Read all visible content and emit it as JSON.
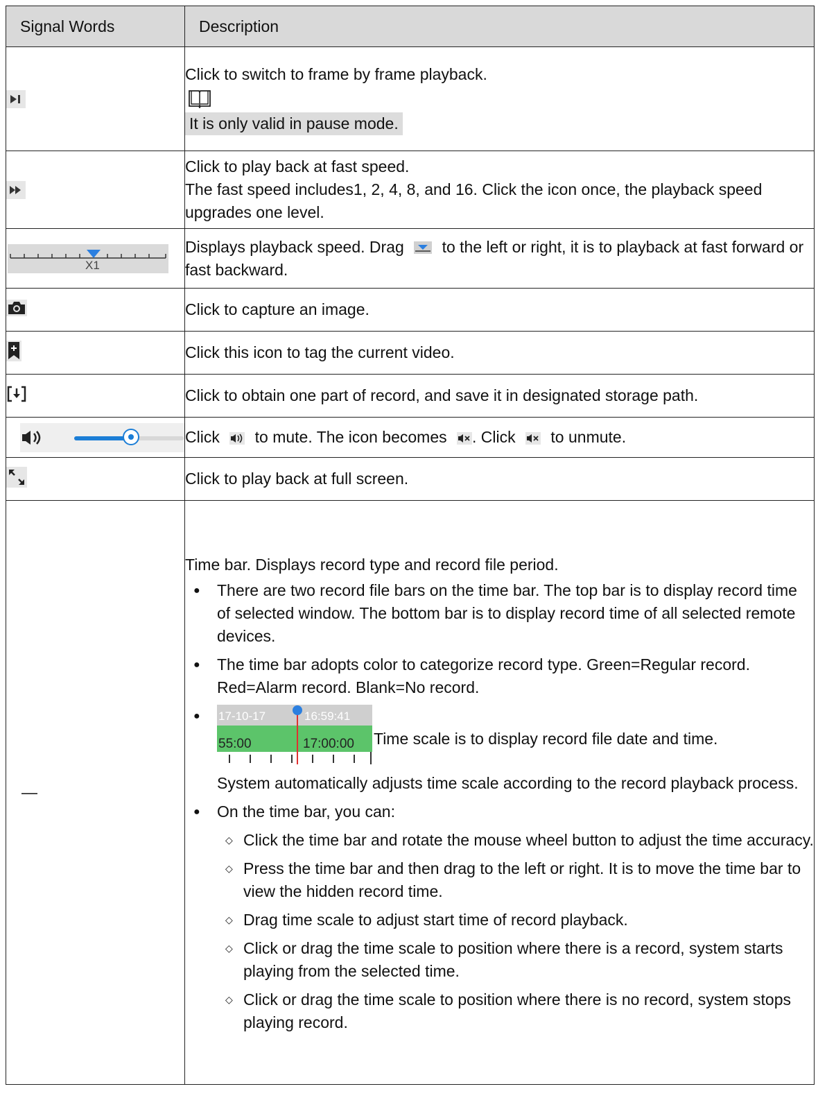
{
  "header": {
    "col1": "Signal Words",
    "col2": "Description"
  },
  "rows": {
    "frame": {
      "desc": "Click to switch to frame by frame playback.",
      "note": "It is only valid in pause mode."
    },
    "fast": {
      "line1": "Click to play back at fast speed.",
      "line2": "The fast speed includes1, 2, 4, 8, and 16. Click the icon once, the playback speed upgrades one level."
    },
    "speed": {
      "icon_label": "X1",
      "pre": "Displays playback speed. Drag",
      "post": "to the left or right, it is to playback at fast forward or fast backward."
    },
    "capture": {
      "desc": "Click to capture an image."
    },
    "tag": {
      "desc": "Click this icon to tag the current video."
    },
    "clip": {
      "desc": "Click to obtain one part of record, and save it in designated storage path."
    },
    "volume": {
      "t1": "Click",
      "t2": "to mute. The icon becomes",
      "t3": ". Click",
      "t4": "to unmute.",
      "level": 0.52
    },
    "fullscreen": {
      "desc": "Click to play back at full screen."
    },
    "timebar": {
      "signal": "—",
      "intro": "Time bar. Displays record type and record file period.",
      "b1": "There are two record file bars on the time bar. The top bar is to display record time of selected window. The bottom bar is to display record time of all selected remote devices.",
      "b2": "The time bar adopts color to categorize record type. Green=Regular record. Red=Alarm record. Blank=No record.",
      "img_date": "17-10-17",
      "img_time": "16:59:41",
      "img_left": "55:00",
      "img_mid": "17:00:00",
      "b3": "Time scale is to display record file date and time.",
      "b3_cont": "System automatically adjusts time scale according to the record playback process.",
      "b4": "On the time bar, you can:",
      "d1": "Click the time bar and rotate the mouse wheel button to adjust the time accuracy.",
      "d2": "Press the time bar and then drag to the left or right. It is to move the time bar to view the hidden record time.",
      "d3": "Drag time scale to adjust start time of record playback.",
      "d4": "Click or drag the time scale to position where there is a record, system starts playing from the selected time.",
      "d5": "Click or drag the time scale to position where there is no record, system stops playing record."
    }
  },
  "colors": {
    "accent_blue": "#1c7ed6",
    "green": "#5cc46a",
    "red": "#e03030",
    "icon_bg": "#e6e6e6"
  }
}
